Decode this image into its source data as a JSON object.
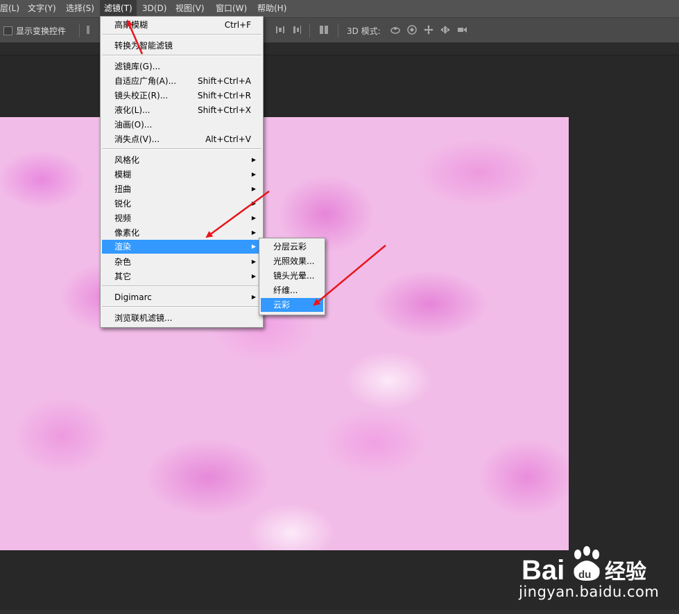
{
  "menubar": {
    "items": [
      "层(L)",
      "文字(Y)",
      "选择(S)",
      "滤镜(T)",
      "3D(D)",
      "视图(V)",
      "窗口(W)",
      "帮助(H)"
    ],
    "active_index": 3
  },
  "options_bar": {
    "show_transform_label": "显示变换控件",
    "mode_3d_label": "3D 模式:"
  },
  "filter_menu": {
    "items": [
      {
        "label": "高斯模糊",
        "shortcut": "Ctrl+F"
      },
      {
        "label": "转换为智能滤镜"
      },
      {
        "label": "滤镜库(G)..."
      },
      {
        "label": "自适应广角(A)...",
        "shortcut": "Shift+Ctrl+A"
      },
      {
        "label": "镜头校正(R)...",
        "shortcut": "Shift+Ctrl+R"
      },
      {
        "label": "液化(L)...",
        "shortcut": "Shift+Ctrl+X"
      },
      {
        "label": "油画(O)..."
      },
      {
        "label": "消失点(V)...",
        "shortcut": "Alt+Ctrl+V"
      },
      {
        "label": "风格化",
        "submenu": true
      },
      {
        "label": "模糊",
        "submenu": true
      },
      {
        "label": "扭曲",
        "submenu": true
      },
      {
        "label": "锐化",
        "submenu": true
      },
      {
        "label": "视频",
        "submenu": true
      },
      {
        "label": "像素化",
        "submenu": true
      },
      {
        "label": "渲染",
        "submenu": true,
        "highlighted": true
      },
      {
        "label": "杂色",
        "submenu": true
      },
      {
        "label": "其它",
        "submenu": true
      },
      {
        "label": "Digimarc",
        "submenu": true
      },
      {
        "label": "浏览联机滤镜..."
      }
    ]
  },
  "render_submenu": {
    "items": [
      {
        "label": "分层云彩"
      },
      {
        "label": "光照效果..."
      },
      {
        "label": "镜头光晕..."
      },
      {
        "label": "纤维..."
      },
      {
        "label": "云彩",
        "highlighted": true
      }
    ]
  },
  "watermark": {
    "brand": "Bai",
    "paw": "du",
    "cn": "经验",
    "url": "jingyan.baidu.com"
  },
  "colors": {
    "menu_highlight": "#3399ff",
    "annotation_arrow": "#e8141b",
    "canvas_pink": "#f2bce8"
  }
}
